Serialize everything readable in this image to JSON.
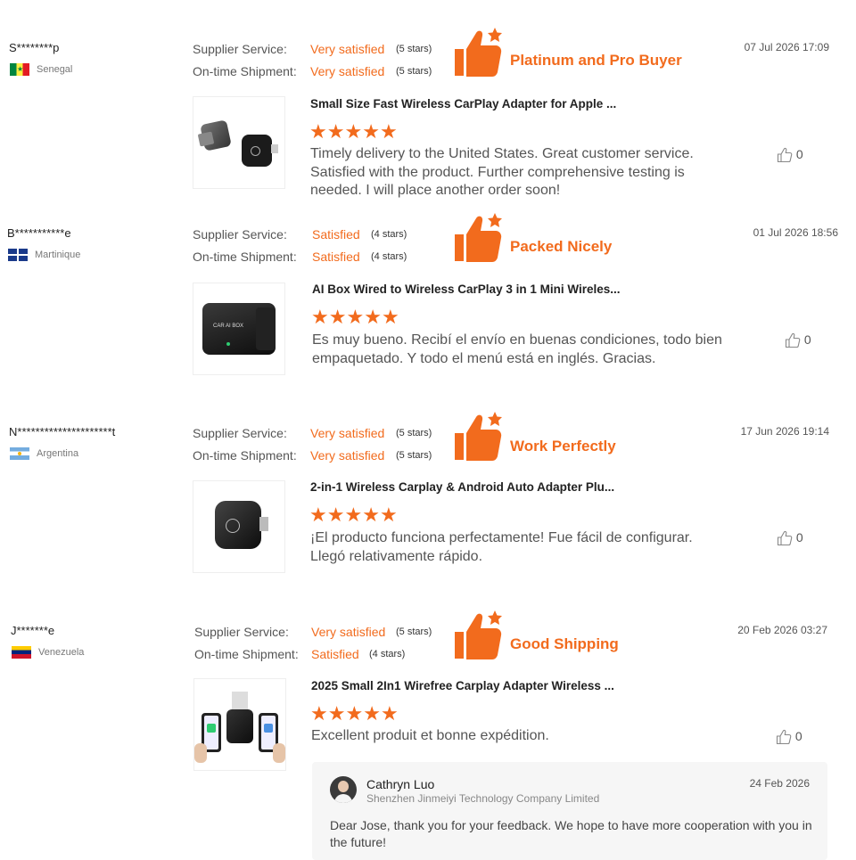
{
  "reviews": [
    {
      "buyer": "S********p",
      "country": "Senegal",
      "supplier_service_label": "Supplier Service:",
      "supplier_service_value": "Very satisfied",
      "supplier_service_stars": "(5 stars)",
      "shipment_label": "On-time Shipment:",
      "shipment_value": "Very satisfied",
      "shipment_stars": "(5 stars)",
      "tag": "Platinum and Pro Buyer",
      "date": "07 Jul 2026 17:09",
      "product_title": "Small Size Fast Wireless CarPlay Adapter for Apple ...",
      "rating": 5,
      "text": "Timely delivery to the United States. Great customer service. Satisfied with the product. Further comprehensive testing is needed. I will place another order soon!",
      "likes": "0"
    },
    {
      "buyer": "B***********e",
      "country": "Martinique",
      "supplier_service_label": "Supplier Service:",
      "supplier_service_value": "Satisfied",
      "supplier_service_stars": "(4 stars)",
      "shipment_label": "On-time Shipment:",
      "shipment_value": "Satisfied",
      "shipment_stars": "(4 stars)",
      "tag": "Packed Nicely",
      "date": "01 Jul 2026 18:56",
      "product_title": "AI Box Wired to Wireless CarPlay 3 in 1 Mini Wireles...",
      "rating": 5,
      "text": "Es muy bueno. Recibí el envío en buenas condiciones, todo bien empaquetado. Y todo el menú está en inglés. Gracias.",
      "likes": "0",
      "image_label": "CAR AI BOX"
    },
    {
      "buyer": "N*********************t",
      "country": "Argentina",
      "supplier_service_label": "Supplier Service:",
      "supplier_service_value": "Very satisfied",
      "supplier_service_stars": "(5 stars)",
      "shipment_label": "On-time Shipment:",
      "shipment_value": "Very satisfied",
      "shipment_stars": "(5 stars)",
      "tag": "Work Perfectly",
      "date": "17 Jun 2026 19:14",
      "product_title": "2-in-1 Wireless Carplay & Android Auto Adapter Plu...",
      "rating": 5,
      "text": "¡El producto funciona perfectamente! Fue fácil de configurar. Llegó relativamente rápido.",
      "likes": "0"
    },
    {
      "buyer": "J*******e",
      "country": "Venezuela",
      "supplier_service_label": "Supplier Service:",
      "supplier_service_value": "Very satisfied",
      "supplier_service_stars": "(5 stars)",
      "shipment_label": "On-time Shipment:",
      "shipment_value": "Satisfied",
      "shipment_stars": "(4 stars)",
      "tag": "Good Shipping",
      "date": "20 Feb 2026 03:27",
      "product_title": "2025 Small 2In1 Wirefree Carplay Adapter Wireless ...",
      "rating": 5,
      "text": "Excellent produit et bonne expédition.",
      "likes": "0"
    }
  ],
  "reply": {
    "name": "Cathryn Luo",
    "company": "Shenzhen Jinmeiyi Technology Company Limited",
    "date": "24 Feb 2026",
    "text": "Dear Jose, thank you for your feedback. We hope to have more cooperation with you in the future!"
  },
  "colors": {
    "accent": "#f26b1d",
    "text": "#555555"
  },
  "icons": {
    "badge": "thumbs-up-star-icon",
    "like": "thumbs-up-outline-icon"
  }
}
